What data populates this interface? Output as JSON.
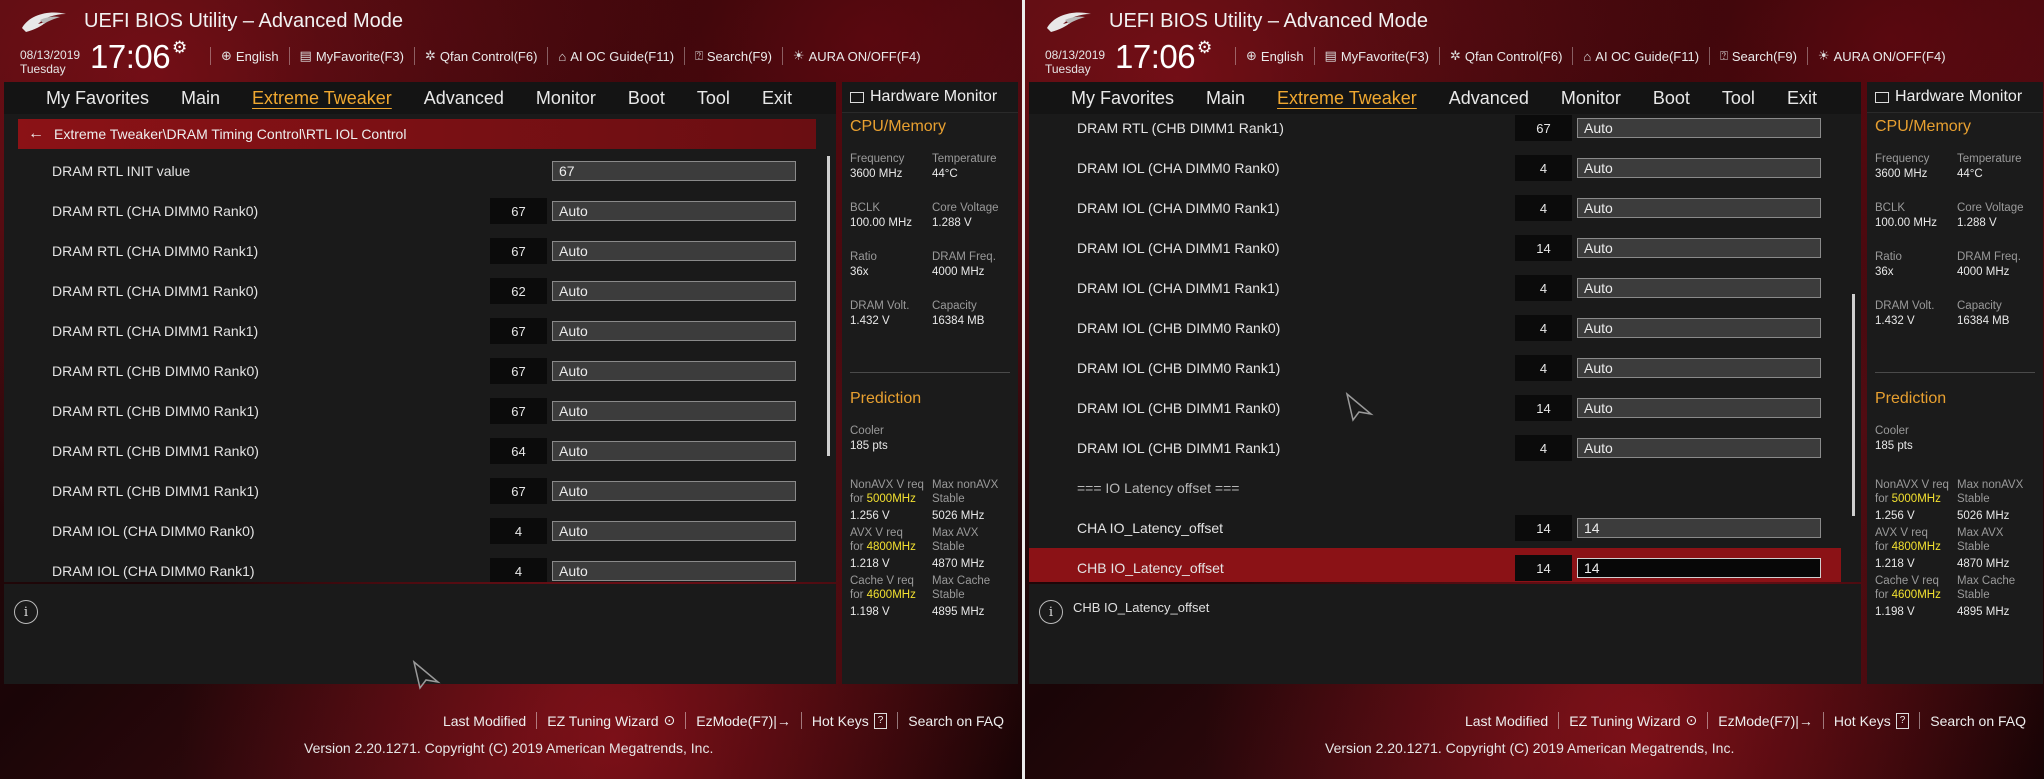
{
  "header": {
    "title": "UEFI BIOS Utility – Advanced Mode",
    "date": "08/13/2019",
    "day": "Tuesday",
    "time": "17:06",
    "toolbar": [
      "English",
      "MyFavorite(F3)",
      "Qfan Control(F6)",
      "AI OC Guide(F11)",
      "Search(F9)",
      "AURA ON/OFF(F4)"
    ]
  },
  "nav": {
    "tabs": [
      "My Favorites",
      "Main",
      "Extreme Tweaker",
      "Advanced",
      "Monitor",
      "Boot",
      "Tool",
      "Exit"
    ],
    "active": "Extreme Tweaker"
  },
  "left": {
    "breadcrumb": "Extreme Tweaker\\DRAM Timing Control\\RTL IOL Control",
    "rows": [
      {
        "label": "DRAM RTL INIT value",
        "current": "",
        "value": "67"
      },
      {
        "label": "DRAM RTL (CHA DIMM0 Rank0)",
        "current": "67",
        "value": "Auto"
      },
      {
        "label": "DRAM RTL (CHA DIMM0 Rank1)",
        "current": "67",
        "value": "Auto"
      },
      {
        "label": "DRAM RTL (CHA DIMM1 Rank0)",
        "current": "62",
        "value": "Auto"
      },
      {
        "label": "DRAM RTL (CHA DIMM1 Rank1)",
        "current": "67",
        "value": "Auto"
      },
      {
        "label": "DRAM RTL (CHB DIMM0 Rank0)",
        "current": "67",
        "value": "Auto"
      },
      {
        "label": "DRAM RTL (CHB DIMM0 Rank1)",
        "current": "67",
        "value": "Auto"
      },
      {
        "label": "DRAM RTL (CHB DIMM1 Rank0)",
        "current": "64",
        "value": "Auto"
      },
      {
        "label": "DRAM RTL (CHB DIMM1 Rank1)",
        "current": "67",
        "value": "Auto"
      },
      {
        "label": "DRAM IOL (CHA DIMM0 Rank0)",
        "current": "4",
        "value": "Auto"
      },
      {
        "label": "DRAM IOL (CHA DIMM0 Rank1)",
        "current": "4",
        "value": "Auto"
      }
    ],
    "info_text": ""
  },
  "right": {
    "rows": [
      {
        "label": "DRAM RTL (CHB DIMM1 Rank1)",
        "current": "67",
        "value": "Auto"
      },
      {
        "label": "DRAM IOL (CHA DIMM0 Rank0)",
        "current": "4",
        "value": "Auto"
      },
      {
        "label": "DRAM IOL (CHA DIMM0 Rank1)",
        "current": "4",
        "value": "Auto"
      },
      {
        "label": "DRAM IOL (CHA DIMM1 Rank0)",
        "current": "14",
        "value": "Auto"
      },
      {
        "label": "DRAM IOL (CHA DIMM1 Rank1)",
        "current": "4",
        "value": "Auto"
      },
      {
        "label": "DRAM IOL (CHB DIMM0 Rank0)",
        "current": "4",
        "value": "Auto"
      },
      {
        "label": "DRAM IOL (CHB DIMM0 Rank1)",
        "current": "4",
        "value": "Auto"
      },
      {
        "label": "DRAM IOL (CHB DIMM1 Rank0)",
        "current": "14",
        "value": "Auto"
      },
      {
        "label": "DRAM IOL (CHB DIMM1 Rank1)",
        "current": "4",
        "value": "Auto"
      },
      {
        "label": "=== IO Latency offset ===",
        "section": true
      },
      {
        "label": "CHA IO_Latency_offset",
        "current": "14",
        "value": "14"
      },
      {
        "label": "CHB IO_Latency_offset",
        "current": "14",
        "value": "14",
        "selected": true
      }
    ],
    "info_text": "CHB IO_Latency_offset"
  },
  "hw": {
    "title": "Hardware Monitor",
    "cpu_title": "CPU/Memory",
    "items": [
      {
        "k": "Frequency",
        "v": "3600 MHz"
      },
      {
        "k": "Temperature",
        "v": "44°C"
      },
      {
        "k": "BCLK",
        "v": "100.00 MHz"
      },
      {
        "k": "Core Voltage",
        "v": "1.288 V"
      },
      {
        "k": "Ratio",
        "v": "36x"
      },
      {
        "k": "DRAM Freq.",
        "v": "4000 MHz"
      },
      {
        "k": "DRAM Volt.",
        "v": "1.432 V"
      },
      {
        "k": "Capacity",
        "v": "16384 MB"
      }
    ],
    "prediction_title": "Prediction",
    "cooler_label": "Cooler",
    "cooler_value": "185 pts",
    "pred": [
      {
        "k1": "NonAVX V req",
        "k2": "for",
        "mhz": "5000MHz",
        "v": "1.256 V",
        "rk1": "Max nonAVX",
        "rk2": "Stable",
        "rv": "5026 MHz"
      },
      {
        "k1": "AVX V req",
        "k2": "for",
        "mhz": "4800MHz",
        "v": "1.218 V",
        "rk1": "Max AVX",
        "rk2": "Stable",
        "rv": "4870 MHz"
      },
      {
        "k1": "Cache V req",
        "k2": "for",
        "mhz": "4600MHz",
        "v": "1.198 V",
        "rk1": "Max Cache",
        "rk2": "Stable",
        "rv": "4895 MHz"
      }
    ]
  },
  "footer": {
    "links": [
      "Last Modified",
      "EZ Tuning Wizard",
      "EzMode(F7)|→",
      "Hot Keys"
    ],
    "search_faq": "Search on FAQ",
    "version": "Version 2.20.1271. Copyright (C) 2019 American Megatrends, Inc."
  },
  "colors": {
    "accent": "#f0a830",
    "selected_row": "#8b1216",
    "highlight_mhz": "#f2e030"
  },
  "icons": [
    "rog-logo-icon",
    "gear-icon",
    "globe-icon",
    "favorite-icon",
    "fan-icon",
    "ai-oc-icon",
    "search-icon",
    "aura-icon",
    "back-arrow-icon",
    "info-icon",
    "monitor-icon",
    "lightbulb-icon",
    "hotkeys-icon"
  ]
}
